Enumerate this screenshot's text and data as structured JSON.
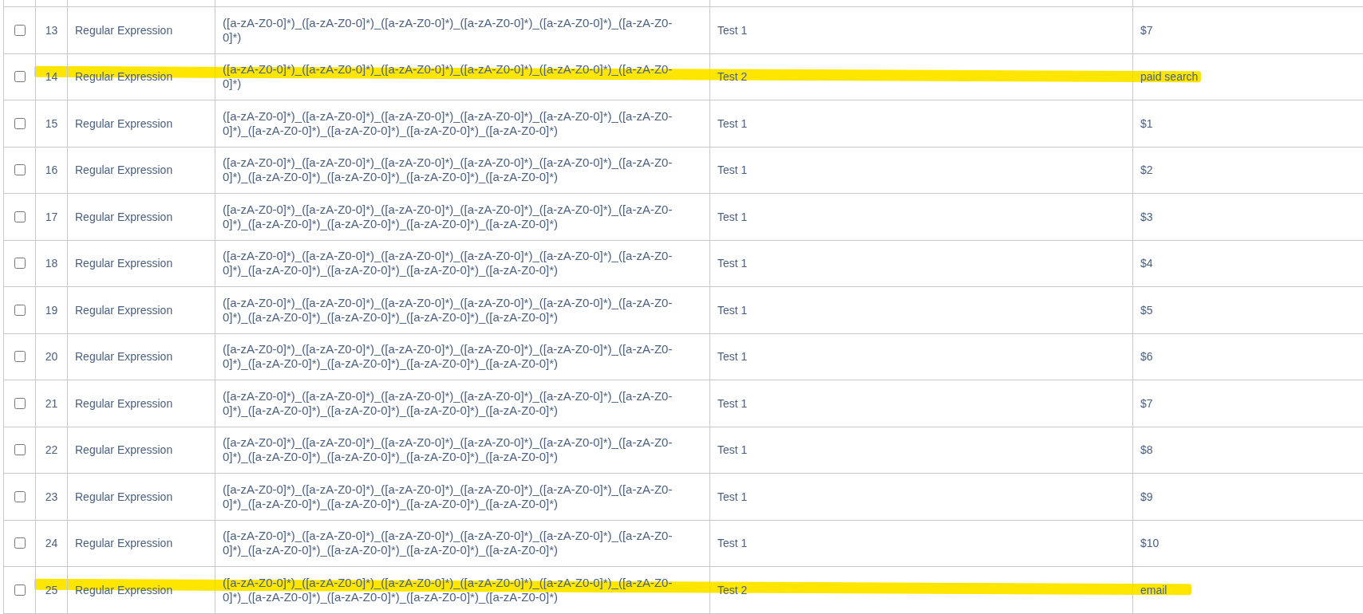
{
  "table": {
    "rows": [
      {
        "checked": false,
        "number": "13",
        "type": "Regular Expression",
        "pattern": "([a-zA-Z0-0]*)_([a-zA-Z0-0]*)_([a-zA-Z0-0]*)_([a-zA-Z0-0]*)_([a-zA-Z0-0]*)_([a-zA-Z0-0]*)",
        "name": "Test 1",
        "value": "$7",
        "highlighted": false
      },
      {
        "checked": false,
        "number": "14",
        "type": "Regular Expression",
        "pattern": "([a-zA-Z0-0]*)_([a-zA-Z0-0]*)_([a-zA-Z0-0]*)_([a-zA-Z0-0]*)_([a-zA-Z0-0]*)_([a-zA-Z0-0]*)",
        "name": "Test 2",
        "value": "paid search",
        "highlighted": true
      },
      {
        "checked": false,
        "number": "15",
        "type": "Regular Expression",
        "pattern": "([a-zA-Z0-0]*)_([a-zA-Z0-0]*)_([a-zA-Z0-0]*)_([a-zA-Z0-0]*)_([a-zA-Z0-0]*)_([a-zA-Z0-0]*)_([a-zA-Z0-0]*)_([a-zA-Z0-0]*)_([a-zA-Z0-0]*)_([a-zA-Z0-0]*)",
        "name": "Test 1",
        "value": "$1",
        "highlighted": false
      },
      {
        "checked": false,
        "number": "16",
        "type": "Regular Expression",
        "pattern": "([a-zA-Z0-0]*)_([a-zA-Z0-0]*)_([a-zA-Z0-0]*)_([a-zA-Z0-0]*)_([a-zA-Z0-0]*)_([a-zA-Z0-0]*)_([a-zA-Z0-0]*)_([a-zA-Z0-0]*)_([a-zA-Z0-0]*)_([a-zA-Z0-0]*)",
        "name": "Test 1",
        "value": "$2",
        "highlighted": false
      },
      {
        "checked": false,
        "number": "17",
        "type": "Regular Expression",
        "pattern": "([a-zA-Z0-0]*)_([a-zA-Z0-0]*)_([a-zA-Z0-0]*)_([a-zA-Z0-0]*)_([a-zA-Z0-0]*)_([a-zA-Z0-0]*)_([a-zA-Z0-0]*)_([a-zA-Z0-0]*)_([a-zA-Z0-0]*)_([a-zA-Z0-0]*)",
        "name": "Test 1",
        "value": "$3",
        "highlighted": false
      },
      {
        "checked": false,
        "number": "18",
        "type": "Regular Expression",
        "pattern": "([a-zA-Z0-0]*)_([a-zA-Z0-0]*)_([a-zA-Z0-0]*)_([a-zA-Z0-0]*)_([a-zA-Z0-0]*)_([a-zA-Z0-0]*)_([a-zA-Z0-0]*)_([a-zA-Z0-0]*)_([a-zA-Z0-0]*)_([a-zA-Z0-0]*)",
        "name": "Test 1",
        "value": "$4",
        "highlighted": false
      },
      {
        "checked": false,
        "number": "19",
        "type": "Regular Expression",
        "pattern": "([a-zA-Z0-0]*)_([a-zA-Z0-0]*)_([a-zA-Z0-0]*)_([a-zA-Z0-0]*)_([a-zA-Z0-0]*)_([a-zA-Z0-0]*)_([a-zA-Z0-0]*)_([a-zA-Z0-0]*)_([a-zA-Z0-0]*)_([a-zA-Z0-0]*)",
        "name": "Test 1",
        "value": "$5",
        "highlighted": false
      },
      {
        "checked": false,
        "number": "20",
        "type": "Regular Expression",
        "pattern": "([a-zA-Z0-0]*)_([a-zA-Z0-0]*)_([a-zA-Z0-0]*)_([a-zA-Z0-0]*)_([a-zA-Z0-0]*)_([a-zA-Z0-0]*)_([a-zA-Z0-0]*)_([a-zA-Z0-0]*)_([a-zA-Z0-0]*)_([a-zA-Z0-0]*)",
        "name": "Test 1",
        "value": "$6",
        "highlighted": false
      },
      {
        "checked": false,
        "number": "21",
        "type": "Regular Expression",
        "pattern": "([a-zA-Z0-0]*)_([a-zA-Z0-0]*)_([a-zA-Z0-0]*)_([a-zA-Z0-0]*)_([a-zA-Z0-0]*)_([a-zA-Z0-0]*)_([a-zA-Z0-0]*)_([a-zA-Z0-0]*)_([a-zA-Z0-0]*)_([a-zA-Z0-0]*)",
        "name": "Test 1",
        "value": "$7",
        "highlighted": false
      },
      {
        "checked": false,
        "number": "22",
        "type": "Regular Expression",
        "pattern": "([a-zA-Z0-0]*)_([a-zA-Z0-0]*)_([a-zA-Z0-0]*)_([a-zA-Z0-0]*)_([a-zA-Z0-0]*)_([a-zA-Z0-0]*)_([a-zA-Z0-0]*)_([a-zA-Z0-0]*)_([a-zA-Z0-0]*)_([a-zA-Z0-0]*)",
        "name": "Test 1",
        "value": "$8",
        "highlighted": false
      },
      {
        "checked": false,
        "number": "23",
        "type": "Regular Expression",
        "pattern": "([a-zA-Z0-0]*)_([a-zA-Z0-0]*)_([a-zA-Z0-0]*)_([a-zA-Z0-0]*)_([a-zA-Z0-0]*)_([a-zA-Z0-0]*)_([a-zA-Z0-0]*)_([a-zA-Z0-0]*)_([a-zA-Z0-0]*)_([a-zA-Z0-0]*)",
        "name": "Test 1",
        "value": "$9",
        "highlighted": false
      },
      {
        "checked": false,
        "number": "24",
        "type": "Regular Expression",
        "pattern": "([a-zA-Z0-0]*)_([a-zA-Z0-0]*)_([a-zA-Z0-0]*)_([a-zA-Z0-0]*)_([a-zA-Z0-0]*)_([a-zA-Z0-0]*)_([a-zA-Z0-0]*)_([a-zA-Z0-0]*)_([a-zA-Z0-0]*)_([a-zA-Z0-0]*)",
        "name": "Test 1",
        "value": "$10",
        "highlighted": false
      },
      {
        "checked": false,
        "number": "25",
        "type": "Regular Expression",
        "pattern": "([a-zA-Z0-0]*)_([a-zA-Z0-0]*)_([a-zA-Z0-0]*)_([a-zA-Z0-0]*)_([a-zA-Z0-0]*)_([a-zA-Z0-0]*)_([a-zA-Z0-0]*)_([a-zA-Z0-0]*)_([a-zA-Z0-0]*)_([a-zA-Z0-0]*)",
        "name": "Test 2",
        "value": "email",
        "highlighted": true
      }
    ]
  }
}
